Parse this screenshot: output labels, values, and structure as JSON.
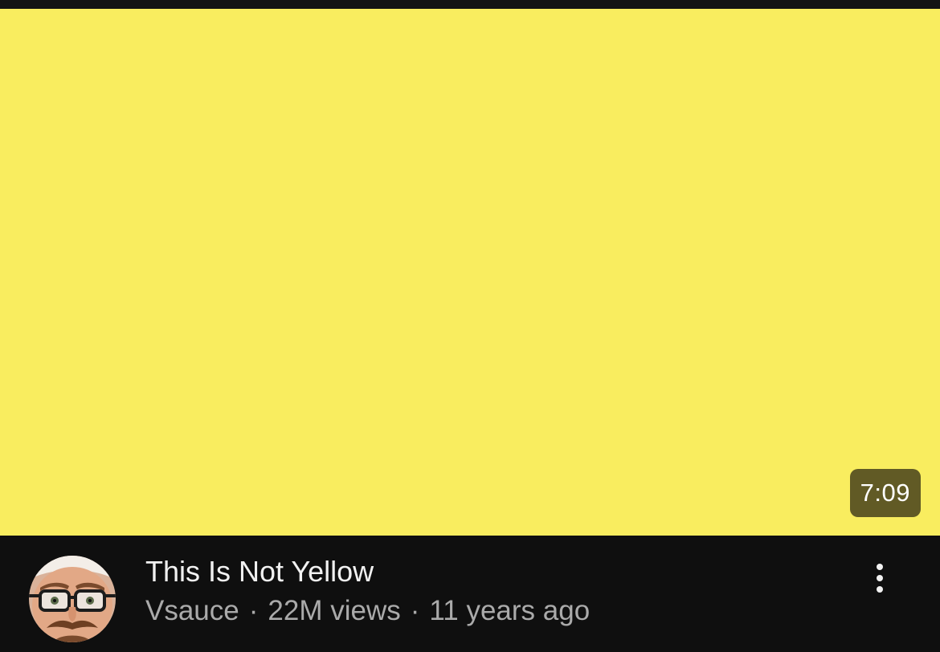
{
  "video": {
    "duration": "7:09",
    "title": "This Is Not Yellow",
    "channel": "Vsauce",
    "views": "22M views",
    "age": "11 years ago",
    "separator": "·",
    "thumbnail_color": "#f9ed5f",
    "badge_color": "#615a25"
  },
  "icons": {
    "more": "vertical-ellipsis-icon",
    "avatar": "channel-avatar"
  },
  "colors": {
    "background": "#0f0f0f",
    "title_text": "#f1f1f1",
    "meta_text": "#aaaaaa"
  }
}
